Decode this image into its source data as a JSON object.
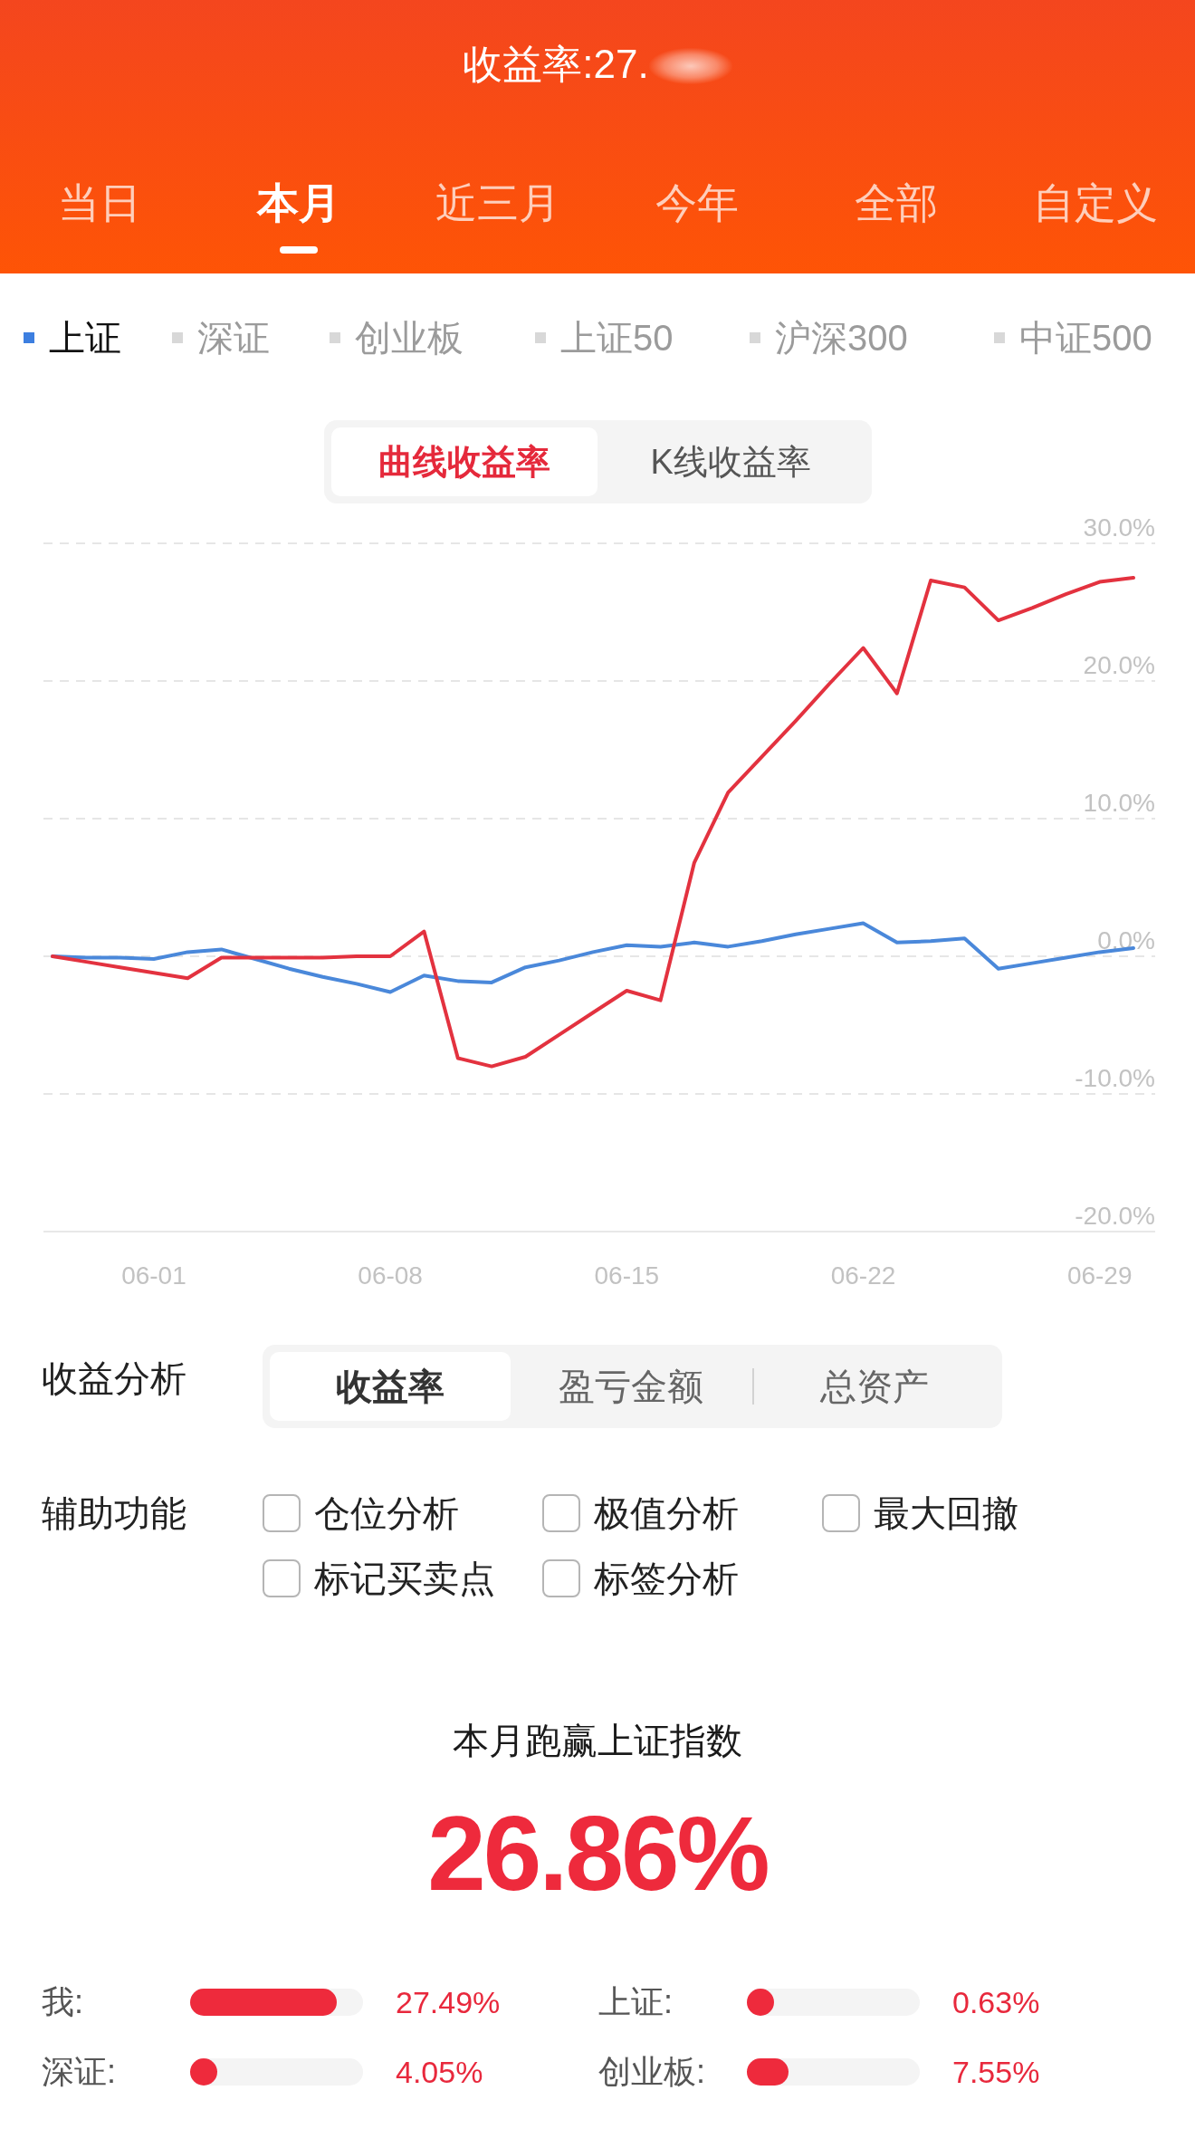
{
  "header": {
    "title": "收益率:27.",
    "value_blurred": true
  },
  "period_tabs": [
    {
      "label": "当日",
      "selected": false
    },
    {
      "label": "本月",
      "selected": true
    },
    {
      "label": "近三月",
      "selected": false
    },
    {
      "label": "今年",
      "selected": false
    },
    {
      "label": "全部",
      "selected": false
    },
    {
      "label": "自定义",
      "selected": false
    }
  ],
  "index_legend": [
    {
      "label": "上证",
      "selected": true
    },
    {
      "label": "深证",
      "selected": false
    },
    {
      "label": "创业板",
      "selected": false
    },
    {
      "label": "上证50",
      "selected": false
    },
    {
      "label": "沪深300",
      "selected": false
    },
    {
      "label": "中证500",
      "selected": false
    }
  ],
  "chart_mode_toggle": [
    {
      "label": "曲线收益率",
      "selected": true
    },
    {
      "label": "K线收益率",
      "selected": false
    }
  ],
  "chart": {
    "chart_data": {
      "type": "line",
      "grid": true,
      "categories": [
        null,
        null,
        null,
        "06-01",
        null,
        null,
        null,
        null,
        null,
        null,
        "06-08",
        null,
        null,
        null,
        null,
        null,
        null,
        "06-15",
        null,
        null,
        null,
        null,
        null,
        null,
        "06-22",
        null,
        null,
        null,
        null,
        null,
        null,
        "06-29",
        null
      ],
      "ylim": [
        -20,
        30
      ],
      "yticks": [
        {
          "value": 30,
          "label": "30.0%"
        },
        {
          "value": 20,
          "label": "20.0%"
        },
        {
          "value": 10,
          "label": "10.0%"
        },
        {
          "value": 0,
          "label": "0.0%"
        },
        {
          "value": -10,
          "label": "-10.0%"
        },
        {
          "value": -20,
          "label": "-20.0%"
        }
      ],
      "series": [
        {
          "color": "#e3323f",
          "values": [
            0.0,
            -0.4,
            -0.8,
            -1.2,
            -1.6,
            -0.1,
            -0.1,
            -0.1,
            -0.1,
            0.0,
            0.0,
            1.8,
            -7.4,
            -8.0,
            -7.3,
            -5.7,
            -4.1,
            -2.5,
            -3.2,
            6.8,
            11.9,
            14.5,
            17.1,
            19.8,
            22.4,
            19.1,
            27.3,
            26.8,
            24.4,
            25.3,
            26.3,
            27.2,
            27.5
          ]
        },
        {
          "color": "#4a88da",
          "values": [
            0.0,
            -0.1,
            -0.1,
            -0.2,
            0.3,
            0.5,
            -0.2,
            -0.9,
            -1.5,
            -2.0,
            -2.6,
            -1.4,
            -1.8,
            -1.9,
            -0.8,
            -0.3,
            0.3,
            0.8,
            0.7,
            1.0,
            0.7,
            1.1,
            1.6,
            2.0,
            2.4,
            1.0,
            1.1,
            1.3,
            -0.9,
            -0.5,
            -0.1,
            0.3,
            0.6
          ]
        }
      ]
    }
  },
  "analysis": {
    "label": "收益分析",
    "options": [
      {
        "label": "收益率",
        "selected": true
      },
      {
        "label": "盈亏金额",
        "selected": false
      },
      {
        "label": "总资产",
        "selected": false
      }
    ]
  },
  "auxiliary": {
    "label": "辅助功能",
    "options": [
      {
        "label": "仓位分析",
        "checked": false
      },
      {
        "label": "极值分析",
        "checked": false
      },
      {
        "label": "最大回撤",
        "checked": false
      },
      {
        "label": "标记买卖点",
        "checked": false
      },
      {
        "label": "标签分析",
        "checked": false
      }
    ]
  },
  "summary": {
    "title": "本月跑赢上证指数",
    "value": "26.86%",
    "comparisons": [
      {
        "label": "我:",
        "level": 0.85,
        "value": "27.49%"
      },
      {
        "label": "上证:",
        "level": 0.02,
        "value": "0.63%"
      },
      {
        "label": "深证:",
        "level": 0.13,
        "value": "4.05%"
      },
      {
        "label": "创业板:",
        "level": 0.24,
        "value": "7.55%"
      }
    ]
  }
}
